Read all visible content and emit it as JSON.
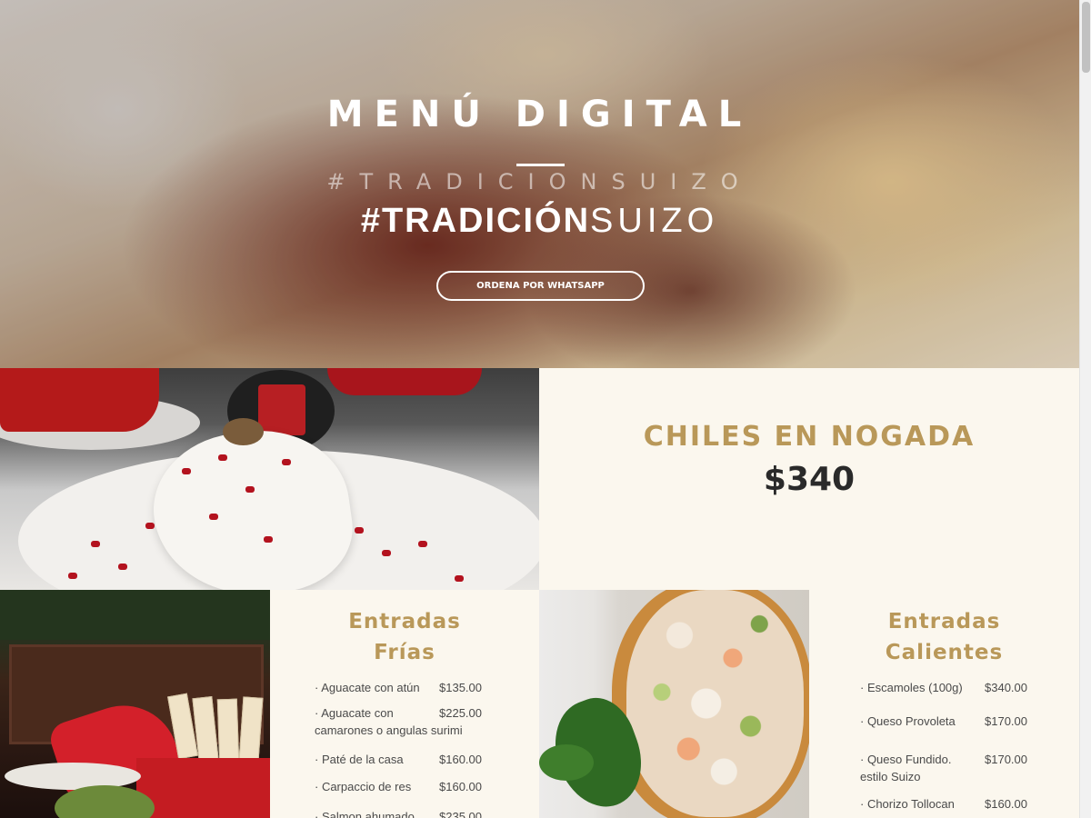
{
  "hero": {
    "title": "MENÚ DIGITAL",
    "hashtag_faint": "#TRADICIONSUIZO",
    "hashtag_bold": "#TRADICIÓN",
    "hashtag_thin": "SUIZO",
    "button_label": "ORDENA POR WHATSAPP"
  },
  "featured": {
    "title": "CHILES EN NOGADA",
    "price": "$340"
  },
  "entradas_frias": {
    "title_line1": "Entradas",
    "title_line2": "Frías",
    "items": [
      {
        "name": "· Aguacate con atún",
        "price": "$135.00"
      },
      {
        "name": "· Aguacate con",
        "sub": "camarones o angulas surimi",
        "price": "$225.00"
      },
      {
        "name": "· Paté de la casa",
        "price": "$160.00"
      },
      {
        "name": "· Carpaccio de res",
        "price": "$160.00"
      },
      {
        "name": "· Salmon ahumado",
        "price": "$235.00"
      }
    ]
  },
  "entradas_calientes": {
    "title_line1": "Entradas",
    "title_line2": "Calientes",
    "items": [
      {
        "name": "· Escamoles (100g)",
        "price": "$340.00"
      },
      {
        "name": "· Queso Provoleta",
        "price": "$170.00"
      },
      {
        "name": "· Queso Fundido.",
        "sub": "estilo Suizo",
        "price": "$170.00"
      },
      {
        "name": "· Chorizo Tollocan",
        "price": "$160.00"
      }
    ]
  },
  "colors": {
    "accent_gold": "#b99859",
    "panel_bg": "#fbf7ee",
    "price_dark": "#2a2a2a"
  }
}
